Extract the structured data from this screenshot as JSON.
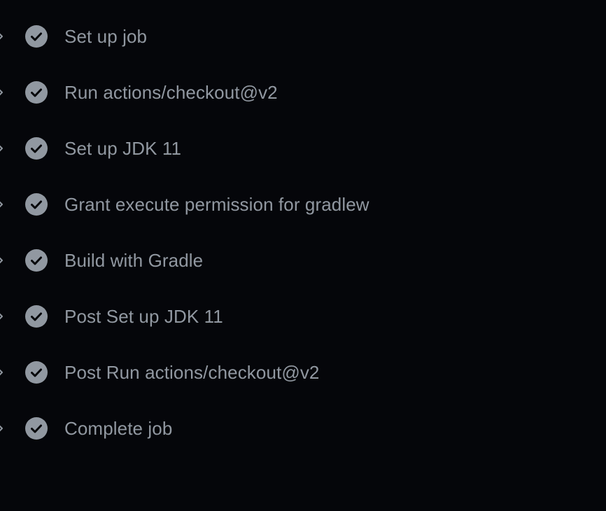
{
  "theme": {
    "background": "#05060a",
    "text_color": "#9198a1",
    "icon_color": "#9198a1"
  },
  "steps": [
    {
      "label": "Set up job",
      "status": "success",
      "icon": "check-circle-fill-icon"
    },
    {
      "label": "Run actions/checkout@v2",
      "status": "success",
      "icon": "check-circle-fill-icon"
    },
    {
      "label": "Set up JDK 11",
      "status": "success",
      "icon": "check-circle-fill-icon"
    },
    {
      "label": "Grant execute permission for gradlew",
      "status": "success",
      "icon": "check-circle-fill-icon"
    },
    {
      "label": "Build with Gradle",
      "status": "success",
      "icon": "check-circle-fill-icon"
    },
    {
      "label": "Post Set up JDK 11",
      "status": "success",
      "icon": "check-circle-fill-icon"
    },
    {
      "label": "Post Run actions/checkout@v2",
      "status": "success",
      "icon": "check-circle-fill-icon"
    },
    {
      "label": "Complete job",
      "status": "success",
      "icon": "check-circle-fill-icon"
    }
  ]
}
